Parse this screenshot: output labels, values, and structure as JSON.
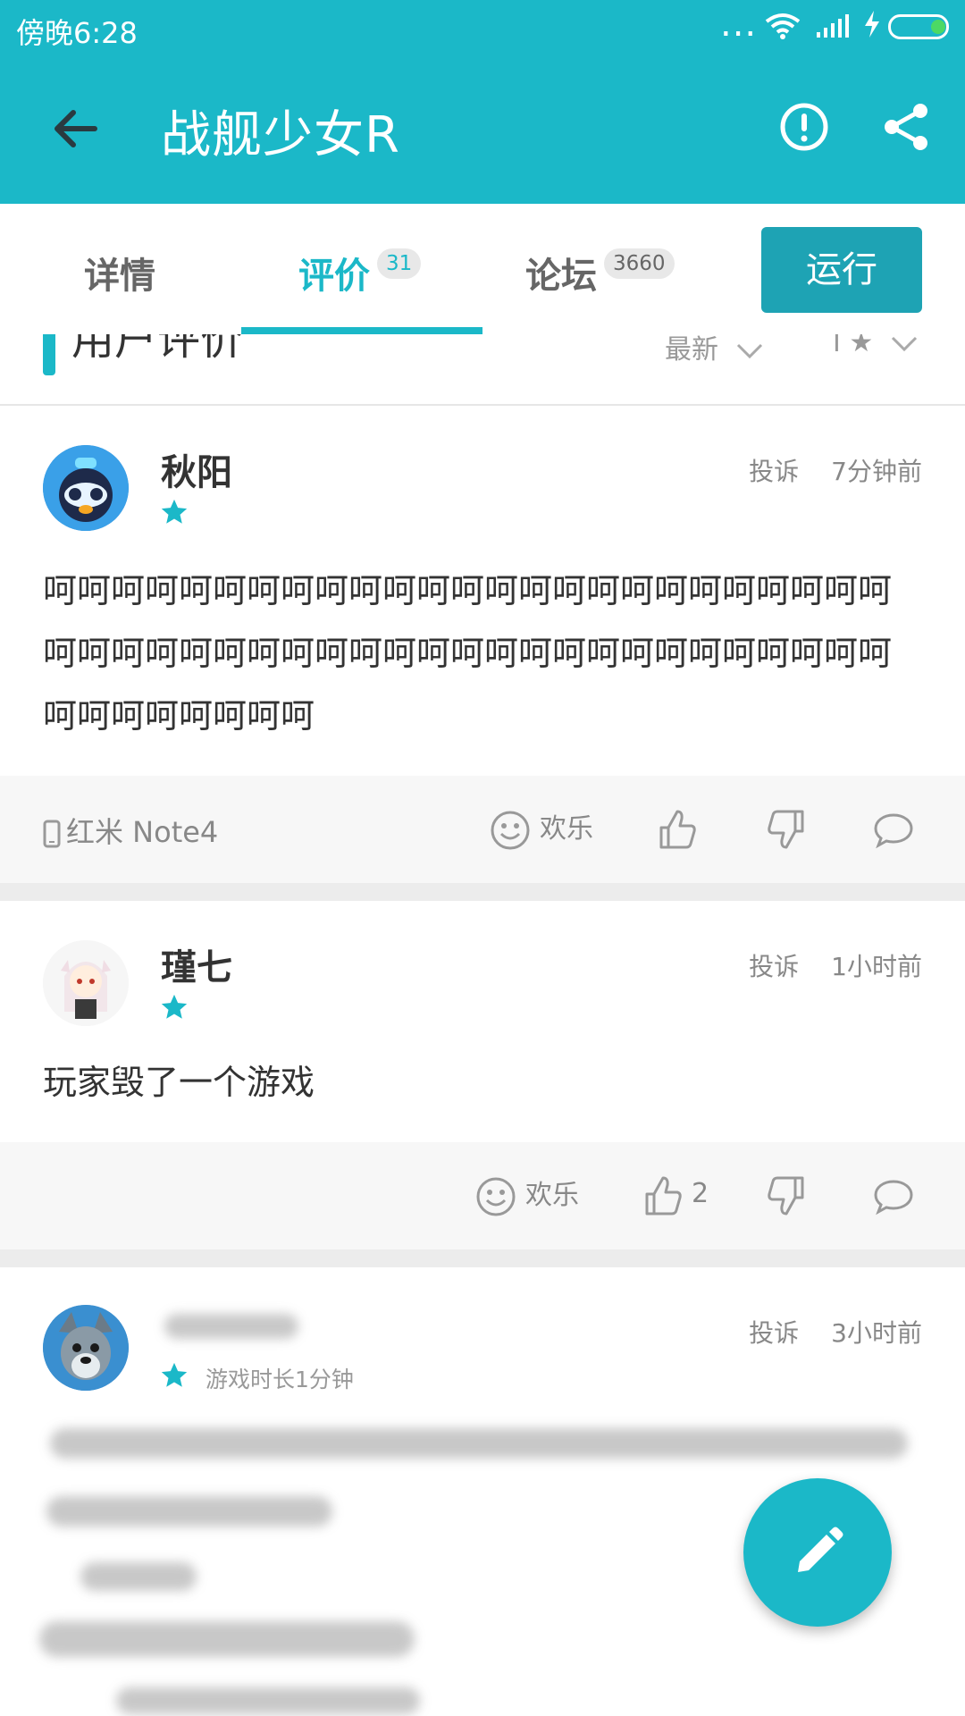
{
  "status_bar": {
    "time": "傍晚6:28",
    "dots": "..."
  },
  "app_bar": {
    "title": "战舰少女R",
    "icons": [
      "back-arrow-icon",
      "report-icon",
      "share-icon"
    ]
  },
  "tabs": [
    {
      "label": "详情",
      "count": ""
    },
    {
      "label": "评价",
      "count": "31",
      "active": true
    },
    {
      "label": "论坛",
      "count": "3660"
    }
  ],
  "run_button": "运行",
  "section": {
    "title": "用户评价",
    "sort": "最新",
    "filter": "I ★"
  },
  "reviews": [
    {
      "user": "秋阳",
      "stars": 1,
      "report": "投诉",
      "time": "7分钟前",
      "content": "呵呵呵呵呵呵呵呵呵呵呵呵呵呵呵呵呵呵呵呵呵呵呵呵呵呵呵呵呵呵呵呵呵呵呵呵呵呵呵呵呵呵呵呵呵呵呵呵呵呵呵呵呵呵呵呵呵呵",
      "device": "红米 Note4",
      "mood": "欢乐",
      "likes": ""
    },
    {
      "user": "瑾七",
      "stars": 1,
      "report": "投诉",
      "time": "1小时前",
      "content": "玩家毁了一个游戏",
      "mood": "欢乐",
      "likes": "2"
    },
    {
      "user": "",
      "stars": 1,
      "report": "投诉",
      "time": "3小时前",
      "playtime": "游戏时长1分钟"
    }
  ],
  "colors": {
    "accent": "#1bb8c8",
    "run_button": "#1ea3b4"
  }
}
